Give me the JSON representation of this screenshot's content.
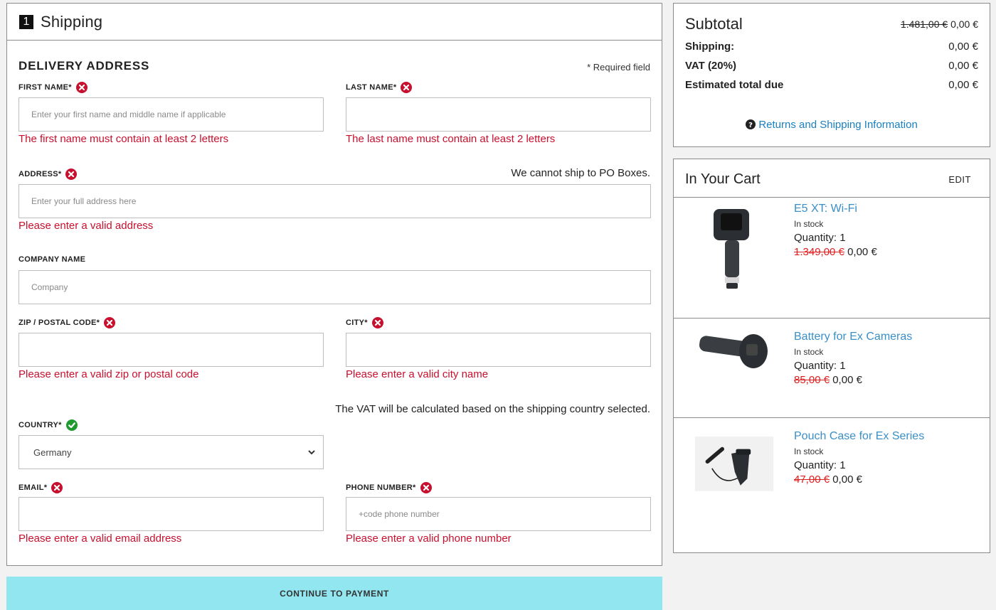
{
  "shipping": {
    "step_number": "1",
    "title": "Shipping",
    "section_title": "DELIVERY ADDRESS",
    "required_note": "* Required field",
    "first_name": {
      "label": "FIRST NAME*",
      "placeholder": "Enter your first name and middle name if applicable",
      "error": "The first name must contain at least 2 letters"
    },
    "last_name": {
      "label": "LAST NAME*",
      "placeholder": "",
      "error": "The last name must contain at least 2 letters"
    },
    "address": {
      "label": "ADDRESS*",
      "hint": "We cannot ship to PO Boxes.",
      "placeholder": "Enter your full address here",
      "error": "Please enter a valid address"
    },
    "company": {
      "label": "COMPANY NAME",
      "placeholder": "Company"
    },
    "zip": {
      "label": "ZIP / POSTAL CODE*",
      "placeholder": "",
      "error": "Please enter a valid zip or postal code"
    },
    "city": {
      "label": "CITY*",
      "placeholder": "",
      "error": "Please enter a valid city name"
    },
    "vat_note": "The VAT will be calculated based on the shipping country selected.",
    "country": {
      "label": "COUNTRY*",
      "value": "Germany"
    },
    "email": {
      "label": "EMAIL*",
      "placeholder": "",
      "error": "Please enter a valid email address"
    },
    "phone": {
      "label": "PHONE NUMBER*",
      "placeholder": "+code phone number",
      "error": "Please enter a valid phone number"
    },
    "continue_label": "CONTINUE TO PAYMENT"
  },
  "summary": {
    "subtotal_label": "Subtotal",
    "subtotal_old": "1.481,00 €",
    "subtotal_new": "0,00 €",
    "shipping_label": "Shipping:",
    "shipping_value": "0,00 €",
    "vat_label": "VAT (20%)",
    "vat_value": "0,00 €",
    "total_label": "Estimated total due",
    "total_value": "0,00 €",
    "returns_link": "Returns and Shipping Information"
  },
  "cart": {
    "title": "In Your Cart",
    "edit_label": "EDIT",
    "items": [
      {
        "name": "E5 XT: Wi-Fi",
        "stock": "In stock",
        "quantity": "Quantity: 1",
        "old_price": "1.349,00 €",
        "new_price": "0,00 €"
      },
      {
        "name": "Battery for Ex Cameras",
        "stock": "In stock",
        "quantity": "Quantity: 1",
        "old_price": "85,00 €",
        "new_price": "0,00 €"
      },
      {
        "name": "Pouch Case for Ex Series",
        "stock": "In stock",
        "quantity": "Quantity: 1",
        "old_price": "47,00 €",
        "new_price": "0,00 €"
      }
    ]
  },
  "colors": {
    "error": "#c8102e",
    "ok": "#1f9a2e",
    "link": "#1a7fc0",
    "cta": "#92e6f0"
  },
  "icons": {
    "error": "x-circle-icon",
    "valid": "check-circle-icon",
    "help": "question-circle-icon",
    "select": "chevron-down-icon"
  }
}
